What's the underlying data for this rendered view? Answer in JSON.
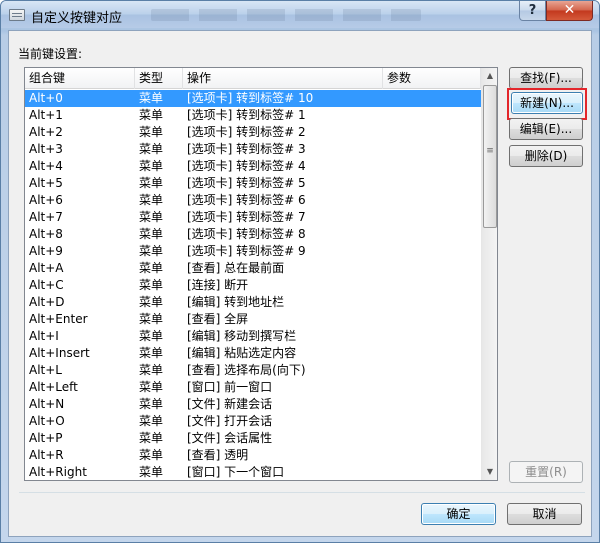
{
  "window": {
    "title": "自定义按键对应",
    "help_label": "?",
    "close_label": "✕"
  },
  "section_label": "当前键设置:",
  "columns": [
    "组合键",
    "类型",
    "操作",
    "参数"
  ],
  "rows": [
    {
      "key": "Alt+0",
      "type": "菜单",
      "action": "[选项卡] 转到标签# 10",
      "param": ""
    },
    {
      "key": "Alt+1",
      "type": "菜单",
      "action": "[选项卡] 转到标签# 1",
      "param": ""
    },
    {
      "key": "Alt+2",
      "type": "菜单",
      "action": "[选项卡] 转到标签# 2",
      "param": ""
    },
    {
      "key": "Alt+3",
      "type": "菜单",
      "action": "[选项卡] 转到标签# 3",
      "param": ""
    },
    {
      "key": "Alt+4",
      "type": "菜单",
      "action": "[选项卡] 转到标签# 4",
      "param": ""
    },
    {
      "key": "Alt+5",
      "type": "菜单",
      "action": "[选项卡] 转到标签# 5",
      "param": ""
    },
    {
      "key": "Alt+6",
      "type": "菜单",
      "action": "[选项卡] 转到标签# 6",
      "param": ""
    },
    {
      "key": "Alt+7",
      "type": "菜单",
      "action": "[选项卡] 转到标签# 7",
      "param": ""
    },
    {
      "key": "Alt+8",
      "type": "菜单",
      "action": "[选项卡] 转到标签# 8",
      "param": ""
    },
    {
      "key": "Alt+9",
      "type": "菜单",
      "action": "[选项卡] 转到标签# 9",
      "param": ""
    },
    {
      "key": "Alt+A",
      "type": "菜单",
      "action": "[查看] 总在最前面",
      "param": ""
    },
    {
      "key": "Alt+C",
      "type": "菜单",
      "action": "[连接] 断开",
      "param": ""
    },
    {
      "key": "Alt+D",
      "type": "菜单",
      "action": "[编辑] 转到地址栏",
      "param": ""
    },
    {
      "key": "Alt+Enter",
      "type": "菜单",
      "action": "[查看] 全屏",
      "param": ""
    },
    {
      "key": "Alt+I",
      "type": "菜单",
      "action": "[编辑] 移动到撰写栏",
      "param": ""
    },
    {
      "key": "Alt+Insert",
      "type": "菜单",
      "action": "[编辑] 粘贴选定内容",
      "param": ""
    },
    {
      "key": "Alt+L",
      "type": "菜单",
      "action": "[查看] 选择布局(向下)",
      "param": ""
    },
    {
      "key": "Alt+Left",
      "type": "菜单",
      "action": "[窗口] 前一窗口",
      "param": ""
    },
    {
      "key": "Alt+N",
      "type": "菜单",
      "action": "[文件] 新建会话",
      "param": ""
    },
    {
      "key": "Alt+O",
      "type": "菜单",
      "action": "[文件] 打开会话",
      "param": ""
    },
    {
      "key": "Alt+P",
      "type": "菜单",
      "action": "[文件] 会话属性",
      "param": ""
    },
    {
      "key": "Alt+R",
      "type": "菜单",
      "action": "[查看] 透明",
      "param": ""
    },
    {
      "key": "Alt+Right",
      "type": "菜单",
      "action": "[窗口] 下一个窗口",
      "param": ""
    }
  ],
  "selected_row": 0,
  "buttons": {
    "find": "查找(F)...",
    "new": "新建(N)...",
    "edit": "编辑(E)...",
    "delete": "删除(D)",
    "reset": "重置(R)",
    "ok": "确定",
    "cancel": "取消"
  },
  "colors": {
    "selection": "#3399ff",
    "highlight_border": "#e3262b",
    "close_button": "#c2381e"
  }
}
